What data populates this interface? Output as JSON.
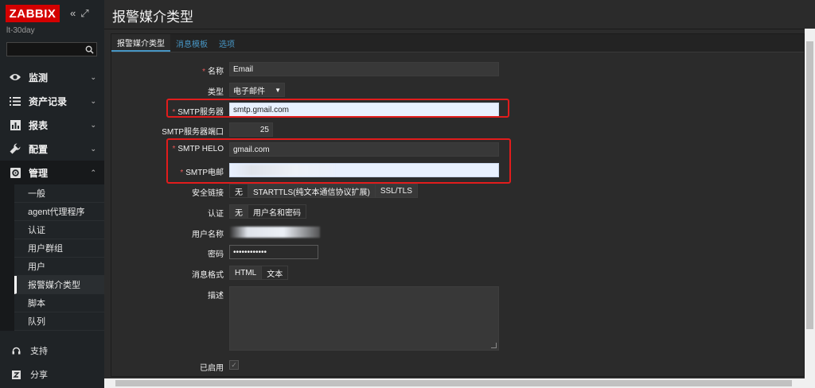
{
  "app": {
    "logo": "ZABBIX",
    "server_name": "lt-30day",
    "collapse_icon": "«",
    "kiosk_icon": "⤢"
  },
  "search": {
    "placeholder": "",
    "icon": "search-icon"
  },
  "menu": [
    {
      "label": "监测",
      "icon": "eye-icon"
    },
    {
      "label": "资产记录",
      "icon": "list-icon"
    },
    {
      "label": "报表",
      "icon": "bar-chart-icon"
    },
    {
      "label": "配置",
      "icon": "wrench-icon"
    },
    {
      "label": "管理",
      "icon": "gear-icon"
    }
  ],
  "submenu": [
    {
      "label": "一般"
    },
    {
      "label": "agent代理程序"
    },
    {
      "label": "认证"
    },
    {
      "label": "用户群组"
    },
    {
      "label": "用户"
    },
    {
      "label": "报警媒介类型"
    },
    {
      "label": "脚本"
    },
    {
      "label": "队列"
    }
  ],
  "bottom": [
    {
      "label": "支持",
      "icon": "headset-icon"
    },
    {
      "label": "分享",
      "icon": "share-icon"
    }
  ],
  "header": {
    "title": "报警媒介类型"
  },
  "tabs": [
    {
      "label": "报警媒介类型"
    },
    {
      "label": "消息模板"
    },
    {
      "label": "选项"
    }
  ],
  "form": {
    "name": {
      "label": "名称",
      "value": "Email"
    },
    "type": {
      "label": "类型",
      "value": "电子邮件"
    },
    "smtp_server": {
      "label": "SMTP服务器",
      "value": "smtp.gmail.com"
    },
    "smtp_port": {
      "label": "SMTP服务器端口",
      "value": "25"
    },
    "smtp_helo": {
      "label": "SMTP HELO",
      "value": "gmail.com"
    },
    "smtp_email": {
      "label": "SMTP电邮"
    },
    "security": {
      "label": "安全链接",
      "options": [
        "无",
        "STARTTLS(纯文本通信协议扩展)",
        "SSL/TLS"
      ]
    },
    "auth": {
      "label": "认证",
      "options": [
        "无",
        "用户名和密码"
      ]
    },
    "username": {
      "label": "用户名称"
    },
    "password": {
      "label": "密码",
      "value": "••••••••••••"
    },
    "msg_format": {
      "label": "消息格式",
      "options": [
        "HTML",
        "文本"
      ]
    },
    "description": {
      "label": "描述"
    },
    "enabled": {
      "label": "已启用",
      "checked": true
    }
  },
  "colors": {
    "accent": "#4796c4",
    "brand": "#d40000",
    "highlight": "#e11c1c",
    "required": "#e45959"
  }
}
